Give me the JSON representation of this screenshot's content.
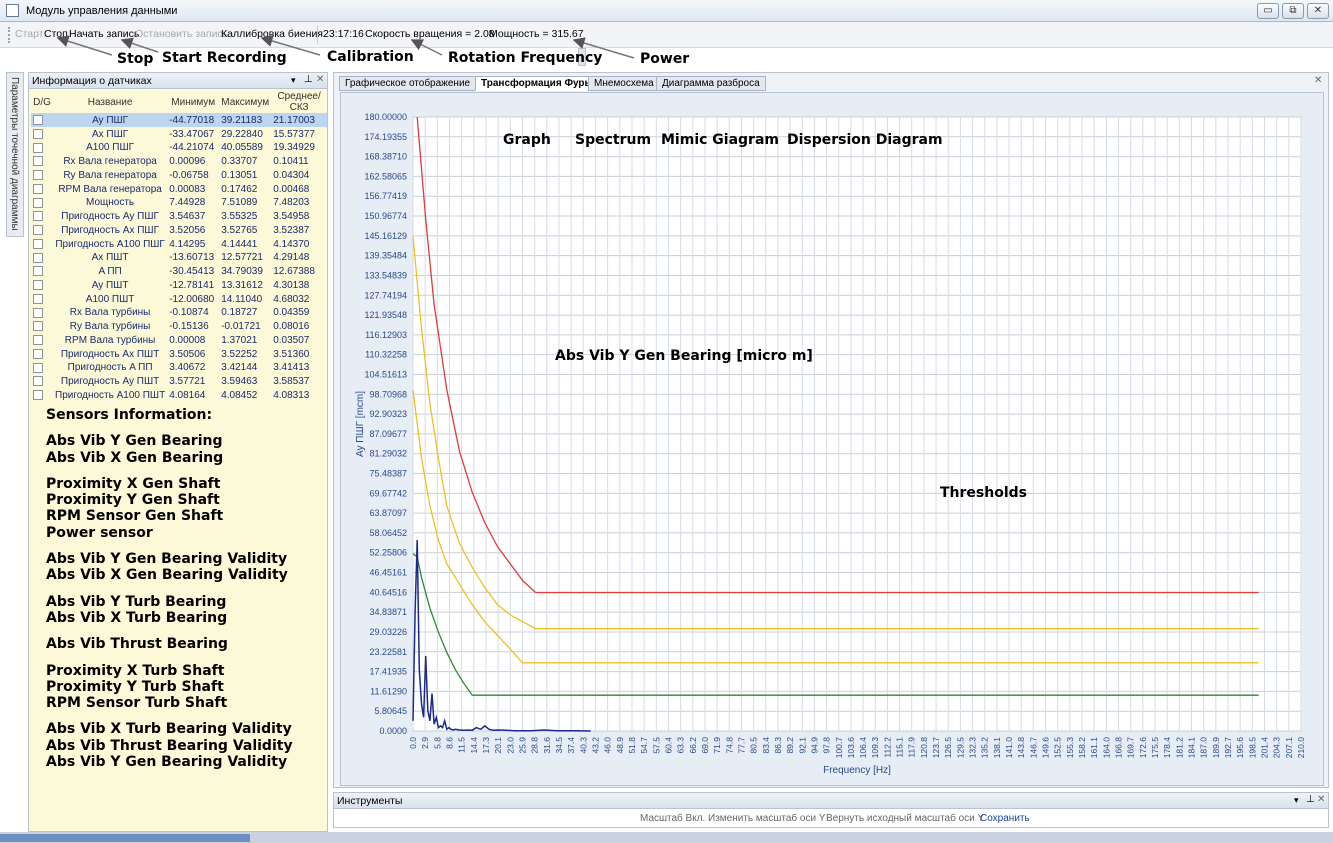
{
  "window": {
    "title": "Модуль управления данными",
    "buttons": [
      "▭",
      "⧉",
      "✕"
    ]
  },
  "toolbar": {
    "start": "Старт",
    "stop": "Стоп",
    "start_record": "Начать запись",
    "stop_record": "Остановить запись",
    "calibration": "Каллибровка биения",
    "time": "23:17:16",
    "rotation": "Скорость вращения = 2.08",
    "power": "Мощность = 315.67"
  },
  "annotations": {
    "stop": "Stop",
    "start_recording": "Start Recording",
    "calibration": "Calibration",
    "rotation_frequency": "Rotation Frequency",
    "power": "Power",
    "graph": "Graph",
    "spectrum": "Spectrum",
    "mimic": "Mimic Giagram",
    "dispersion": "Dispersion Diagram",
    "abs_vib": "Abs Vib Y Gen Bearing [micro m]",
    "thresholds": "Thresholds"
  },
  "side_tab": "Параметры точечной диаграммы",
  "sensor_panel": {
    "title": "Информация о датчиках",
    "columns": [
      "D/G",
      "Название",
      "Минимум",
      "Максимум",
      "Среднее/СКЗ"
    ],
    "rows": [
      [
        "Ay ПШГ",
        "-44.77018",
        "39.21183",
        "21.17003"
      ],
      [
        "Ax ПШГ",
        "-33.47067",
        "29.22840",
        "15.57377"
      ],
      [
        "A100 ПШГ",
        "-44.21074",
        "40.05589",
        "19.34929"
      ],
      [
        "Rx Вала генератора",
        "0.00096",
        "0.33707",
        "0.10411"
      ],
      [
        "Ry Вала генератора",
        "-0.06758",
        "0.13051",
        "0.04304"
      ],
      [
        "RPM Вала генератора",
        "0.00083",
        "0.17462",
        "0.00468"
      ],
      [
        "Мощность",
        "7.44928",
        "7.51089",
        "7.48203"
      ],
      [
        "Пригодность Ay ПШГ",
        "3.54637",
        "3.55325",
        "3.54958"
      ],
      [
        "Пригодность Ax ПШГ",
        "3.52056",
        "3.52765",
        "3.52387"
      ],
      [
        "Пригодность A100 ПШГ",
        "4.14295",
        "4.14441",
        "4.14370"
      ],
      [
        "Ax ПШТ",
        "-13.60713",
        "12.57721",
        "4.29148"
      ],
      [
        "A ПП",
        "-30.45413",
        "34.79039",
        "12.67388"
      ],
      [
        "Ay ПШТ",
        "-12.78141",
        "13.31612",
        "4.30138"
      ],
      [
        "A100 ПШТ",
        "-12.00680",
        "14.11040",
        "4.68032"
      ],
      [
        "Rx Вала турбины",
        "-0.10874",
        "0.18727",
        "0.04359"
      ],
      [
        "Ry Вала турбины",
        "-0.15136",
        "-0.01721",
        "0.08016"
      ],
      [
        "RPM Вала турбины",
        "0.00008",
        "1.37021",
        "0.03507"
      ],
      [
        "Пригодность Ax ПШТ",
        "3.50506",
        "3.52252",
        "3.51360"
      ],
      [
        "Пригодность A ПП",
        "3.40672",
        "3.42144",
        "3.41413"
      ],
      [
        "Пригодность Ay ПШТ",
        "3.57721",
        "3.59463",
        "3.58537"
      ],
      [
        "Пригодность A100 ПШТ",
        "4.08164",
        "4.08452",
        "4.08313"
      ]
    ]
  },
  "sensors_info": {
    "heading": "Sensors Information:",
    "groups": [
      [
        "Abs Vib Y Gen Bearing",
        "Abs Vib X Gen Bearing"
      ],
      [
        "Proximity X Gen Shaft",
        "Proximity Y Gen Shaft",
        "RPM Sensor Gen Shaft",
        "Power sensor"
      ],
      [
        "Abs Vib Y Gen Bearing Validity",
        "Abs Vib X Gen Bearing Validity"
      ],
      [
        "Abs Vib Y Turb Bearing",
        "Abs Vib X Turb Bearing"
      ],
      [
        "Abs Vib Thrust Bearing"
      ],
      [
        "Proximity X Turb Shaft",
        "Proximity Y Turb Shaft",
        "RPM Sensor Turb Shaft"
      ],
      [
        "Abs Vib X Turb Bearing Validity",
        "Abs Vib Thrust Bearing Validity",
        "Abs Vib Y Gen Bearing Validity"
      ]
    ]
  },
  "tabs": [
    "Графическое отображение",
    "Трансформация Фурье",
    "Мнемосхема",
    "Диаграмма разброса"
  ],
  "active_tab": 1,
  "chart_data": {
    "type": "line",
    "xlabel": "Frequency [Hz]",
    "ylabel": "Ay ПШГ [mcm]",
    "ylim": [
      0,
      180
    ],
    "xlim": [
      0,
      210
    ],
    "y_ticks": [
      "0.0000",
      "5.80645",
      "11.61290",
      "17.41935",
      "23.22581",
      "29.03226",
      "34.83871",
      "40.64516",
      "46.45161",
      "52.25806",
      "58.06452",
      "63.87097",
      "69.67742",
      "75.48387",
      "81.29032",
      "87.09677",
      "92.90323",
      "98.70968",
      "104.51613",
      "110.32258",
      "116.12903",
      "121.93548",
      "127.74194",
      "133.54839",
      "139.35484",
      "145.16129",
      "150.96774",
      "156.77419",
      "162.58065",
      "168.38710",
      "174.19355",
      "180.00000"
    ],
    "x_ticks": [
      "0.0",
      "2.9",
      "5.8",
      "8.6",
      "11.5",
      "14.4",
      "17.3",
      "20.1",
      "23.0",
      "25.9",
      "28.8",
      "31.6",
      "34.5",
      "37.4",
      "40.3",
      "43.2",
      "46.0",
      "48.9",
      "51.8",
      "54.7",
      "57.5",
      "60.4",
      "63.3",
      "66.2",
      "69.0",
      "71.9",
      "74.8",
      "77.7",
      "80.5",
      "83.4",
      "86.3",
      "89.2",
      "92.1",
      "94.9",
      "97.8",
      "100.7",
      "103.6",
      "106.4",
      "109.3",
      "112.2",
      "115.1",
      "117.9",
      "120.8",
      "123.7",
      "126.5",
      "129.5",
      "132.3",
      "135.2",
      "138.1",
      "141.0",
      "143.8",
      "146.7",
      "149.6",
      "152.5",
      "155.3",
      "158.2",
      "161.1",
      "164.0",
      "166.8",
      "169.7",
      "172.6",
      "175.5",
      "178.4",
      "181.2",
      "184.1",
      "187.0",
      "189.9",
      "192.7",
      "195.6",
      "198.5",
      "201.4",
      "204.3",
      "207.1",
      "210.0"
    ],
    "series": [
      {
        "color": "#e03a3a",
        "x": [
          1.0,
          3,
          5,
          8,
          11,
          14,
          17,
          20,
          23,
          26,
          29,
          200
        ],
        "y": [
          180,
          150,
          125,
          100,
          82,
          70,
          61,
          54,
          49,
          44,
          40.6,
          40.6
        ]
      },
      {
        "color": "#f0c020",
        "x": [
          0,
          2,
          4,
          6,
          8,
          11,
          14,
          17,
          20,
          23,
          26,
          29,
          200
        ],
        "y": [
          145,
          118,
          96,
          80,
          66,
          55,
          48,
          42,
          37,
          34,
          32,
          30,
          30
        ]
      },
      {
        "color": "#f0c020",
        "x": [
          0,
          2,
          4,
          6,
          8,
          11,
          14,
          17,
          20,
          23,
          25.9,
          200
        ],
        "y": [
          100,
          80,
          66,
          56,
          49,
          43,
          37,
          32,
          28,
          24,
          20,
          20
        ]
      },
      {
        "color": "#2f8a2f",
        "x": [
          0,
          1,
          2,
          4,
          6,
          8,
          10,
          12,
          14,
          200
        ],
        "y": [
          52,
          51,
          45,
          36,
          29,
          23,
          18,
          14,
          10.5,
          10.5
        ]
      },
      {
        "color": "#1a2a8a",
        "x": [
          0.0,
          0.5,
          1.0,
          1.5,
          2.0,
          2.5,
          3.0,
          3.5,
          4.0,
          4.5,
          5.0,
          5.5,
          6.0,
          6.5,
          7.0,
          7.5,
          8.0,
          8.5,
          9.0,
          9.5,
          10.0,
          11.0,
          12.0,
          13.0,
          14.0,
          15.0,
          16.0,
          17.0,
          18.0,
          19.0,
          20.0,
          22.0,
          24.0,
          28.0,
          31.0,
          34.0,
          38.0,
          42.0
        ],
        "y": [
          3,
          35,
          56,
          18,
          8,
          4,
          22,
          6,
          3,
          11,
          2,
          4,
          1,
          1.5,
          1,
          3,
          0.5,
          1,
          0.5,
          0.3,
          0.5,
          0.3,
          0.2,
          0.3,
          0.2,
          1,
          0.5,
          1.5,
          0.5,
          0.2,
          0.3,
          0.2,
          0.1,
          0.1,
          0.3,
          0.1,
          0.1,
          0
        ]
      }
    ]
  },
  "tools_panel": {
    "title": "Инструменты",
    "items": [
      "Масштаб Вкл.",
      "Изменить масштаб оси Y",
      "Вернуть исходный масштаб оси Y",
      "Сохранить"
    ]
  }
}
